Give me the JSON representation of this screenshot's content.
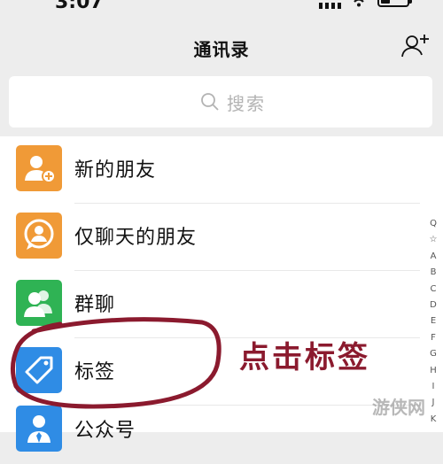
{
  "status_bar": {
    "time": "3:07"
  },
  "nav": {
    "title": "通讯录",
    "add_friend_icon": "add-friend-icon"
  },
  "search": {
    "placeholder": "搜索",
    "icon": "search-icon"
  },
  "contacts": [
    {
      "label": "新的朋友",
      "icon": "new-friend-icon",
      "color": "#f09a37"
    },
    {
      "label": "仅聊天的朋友",
      "icon": "chat-only-friend-icon",
      "color": "#f09a37"
    },
    {
      "label": "群聊",
      "icon": "group-chat-icon",
      "color": "#2fb354"
    },
    {
      "label": "标签",
      "icon": "tag-icon",
      "color": "#2f8ce5"
    },
    {
      "label": "公众号",
      "icon": "official-account-icon",
      "color": "#2f8ce5"
    }
  ],
  "index_bar": [
    "Q",
    "☆",
    "A",
    "B",
    "C",
    "D",
    "E",
    "F",
    "G",
    "H",
    "I",
    "J",
    "K"
  ],
  "annotation": {
    "text": "点击标签",
    "color": "#8b1a2e"
  },
  "watermark": {
    "text": "游侠网"
  }
}
